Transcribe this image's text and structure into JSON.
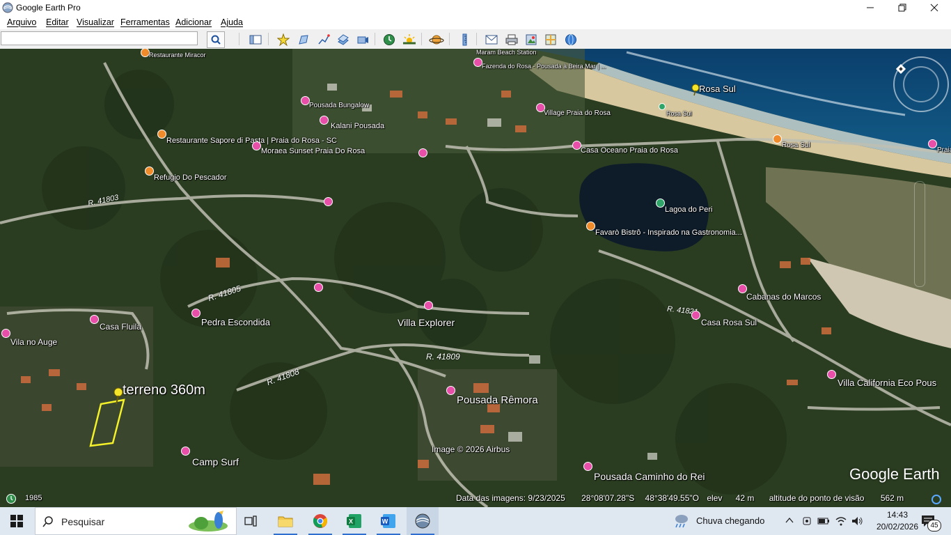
{
  "window": {
    "title": "Google Earth Pro"
  },
  "menu": [
    "Arquivo",
    "Editar",
    "Visualizar",
    "Ferramentas",
    "Adicionar",
    "Ajuda"
  ],
  "search": {
    "value": "",
    "placeholder": ""
  },
  "map": {
    "places": {
      "restaurante_miracor": "Restaurante Miracor",
      "pousada_bungalow": "Pousada Bungalow",
      "kalani": "Kalani Pousada",
      "sapore": "Restaurante Sapore di Pasta | Praia do Rosa - SC",
      "moraea": "Moraea Sunset Praia Do Rosa",
      "refugio": "Refugio Do Pescador",
      "maram": "Maram Beach Station",
      "fazenda": "Fazenda do Rosa - Pousada à Beira Mar | ...",
      "village": "Village Praia do Rosa",
      "casa_oceano": "Casa Oceano Praia do Rosa",
      "rosa_sul_marker": "Rosa Sul",
      "rosa_sul_small": "Rosa Sul",
      "rosa_sul_road": "Rosa Sul",
      "praia": "Praia",
      "lagoa": "Lagoa do Peri",
      "favaro": "Favarò Bistrô - Inspirado na Gastronomia...",
      "cabanas": "Cabanas do Marcos",
      "casa_rosa_sul": "Casa Rosa Sul",
      "villa_california": "Villa California Eco Pous",
      "vila_auge": "Vila no Auge",
      "casa_fluila": "Casa Fluila",
      "pedra_escondida": "Pedra Escondida",
      "villa_explorer": "Villa Explorer",
      "terreno": "terreno 360m",
      "pousada_remora": "Pousada Rêmora",
      "camp_surf": "Camp Surf",
      "caminho_rei": "Pousada Caminho do Rei"
    },
    "roads": {
      "r41803": "R. 41803",
      "r41805": "R. 41805",
      "r41808": "R. 41808",
      "r41809": "R. 41809",
      "r41821": "R. 41821"
    },
    "copyright": "Image © 2026 Airbus",
    "logo": "Google Earth",
    "year": "1985",
    "status": {
      "date_label": "Data das imagens: 9/23/2025",
      "lat": "28°08'07.28\"S",
      "lon": "48°38'49.55\"O",
      "elev_label": "elev",
      "elev_value": "42 m",
      "eye_label": "altitude do ponto de visão",
      "eye_value": "562 m"
    }
  },
  "taskbar": {
    "search_placeholder": "Pesquisar",
    "weather": "Chuva chegando",
    "time": "14:43",
    "date": "20/02/2026",
    "notifications": "45"
  },
  "colors": {
    "poi_pink": "#e84fa8",
    "poi_orange": "#ef8b2a",
    "polygon_yellow": "#f4f12a",
    "taskbar_bg": "#dfe7f1"
  }
}
